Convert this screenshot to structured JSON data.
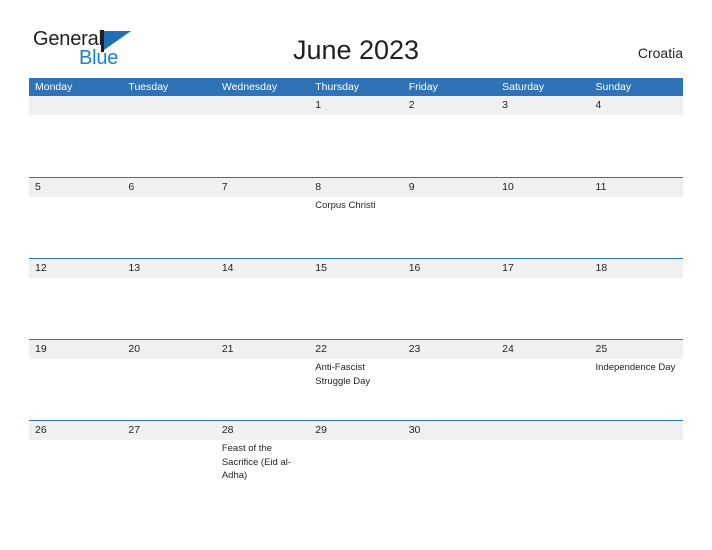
{
  "brand": {
    "word_one": "General",
    "word_two": "Blue",
    "mark": "flag-triangle"
  },
  "header": {
    "title": "June 2023",
    "region": "Croatia"
  },
  "calendar": {
    "weekdays": [
      "Monday",
      "Tuesday",
      "Wednesday",
      "Thursday",
      "Friday",
      "Saturday",
      "Sunday"
    ],
    "accent_color": "#2f72b5",
    "band_color": "#f0f0f0",
    "weeks": [
      {
        "days": [
          {
            "num": "",
            "events": []
          },
          {
            "num": "",
            "events": []
          },
          {
            "num": "",
            "events": []
          },
          {
            "num": "1",
            "events": []
          },
          {
            "num": "2",
            "events": []
          },
          {
            "num": "3",
            "events": []
          },
          {
            "num": "4",
            "events": []
          }
        ]
      },
      {
        "days": [
          {
            "num": "5",
            "events": []
          },
          {
            "num": "6",
            "events": []
          },
          {
            "num": "7",
            "events": []
          },
          {
            "num": "8",
            "events": [
              "Corpus Christi"
            ]
          },
          {
            "num": "9",
            "events": []
          },
          {
            "num": "10",
            "events": []
          },
          {
            "num": "11",
            "events": []
          }
        ]
      },
      {
        "days": [
          {
            "num": "12",
            "events": []
          },
          {
            "num": "13",
            "events": []
          },
          {
            "num": "14",
            "events": []
          },
          {
            "num": "15",
            "events": []
          },
          {
            "num": "16",
            "events": []
          },
          {
            "num": "17",
            "events": []
          },
          {
            "num": "18",
            "events": []
          }
        ]
      },
      {
        "days": [
          {
            "num": "19",
            "events": []
          },
          {
            "num": "20",
            "events": []
          },
          {
            "num": "21",
            "events": []
          },
          {
            "num": "22",
            "events": [
              "Anti-Fascist Struggle Day"
            ]
          },
          {
            "num": "23",
            "events": []
          },
          {
            "num": "24",
            "events": []
          },
          {
            "num": "25",
            "events": [
              "Independence Day"
            ]
          }
        ]
      },
      {
        "days": [
          {
            "num": "26",
            "events": []
          },
          {
            "num": "27",
            "events": []
          },
          {
            "num": "28",
            "events": [
              "Feast of the Sacrifice (Eid al-Adha)"
            ]
          },
          {
            "num": "29",
            "events": []
          },
          {
            "num": "30",
            "events": []
          },
          {
            "num": "",
            "events": []
          },
          {
            "num": "",
            "events": []
          }
        ]
      }
    ]
  }
}
